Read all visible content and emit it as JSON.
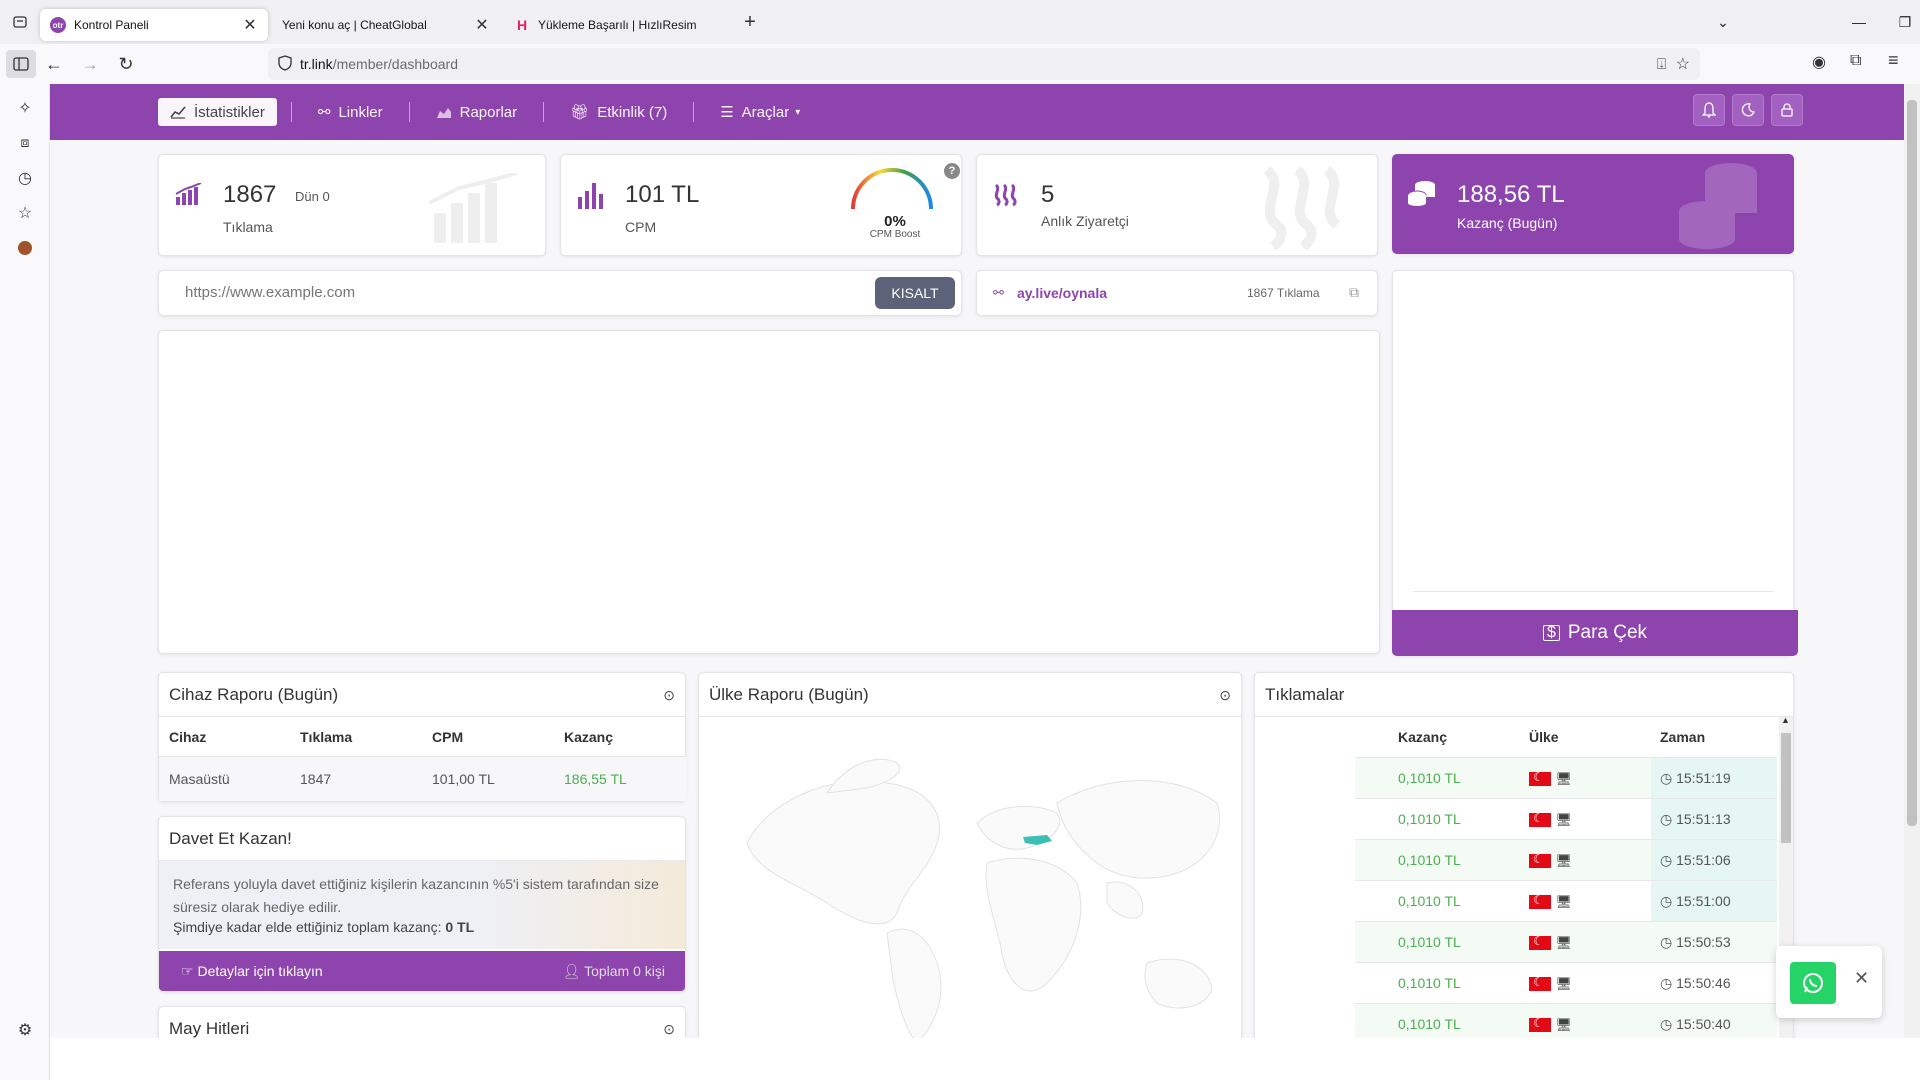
{
  "browser": {
    "tabs": [
      {
        "title": "Kontrol Paneli",
        "favicon": "otr"
      },
      {
        "title": "Yeni konu aç | CheatGlobal",
        "favicon": ""
      },
      {
        "title": "Yükleme Başarılı | HızlıResim",
        "favicon": "H"
      }
    ],
    "url_host": "tr.link",
    "url_path": "/member/dashboard"
  },
  "nav": {
    "items": [
      "İstatistikler",
      "Linkler",
      "Raporlar",
      "Etkinlik (7)",
      "Araçlar"
    ],
    "accent": "#8e44ad"
  },
  "stats": {
    "clicks": {
      "value": "1867",
      "yesterday": "Dün 0",
      "label": "Tıklama"
    },
    "cpm": {
      "value": "101 TL",
      "label": "CPM",
      "boost_value": "0%",
      "boost_label": "CPM Boost",
      "help": "?",
      "boost_percent": 0
    },
    "visitors": {
      "value": "5",
      "label": "Anlık Ziyaretçi"
    },
    "earnings": {
      "value": "188,56 TL",
      "label": "Kazanç (Bugün)"
    }
  },
  "shorten": {
    "placeholder": "https://www.example.com",
    "button": "KISALT"
  },
  "recent_link": {
    "url": "ay.live/oynala",
    "clicks": "1867 Tıklama"
  },
  "withdraw_button": "Para Çek",
  "device_report": {
    "title": "Cihaz Raporu (Bugün)",
    "headers": [
      "Cihaz",
      "Tıklama",
      "CPM",
      "Kazanç"
    ],
    "rows": [
      [
        "Masaüstü",
        "1847",
        "101,00 TL",
        "186,55 TL"
      ]
    ]
  },
  "invite": {
    "title": "Davet Et Kazan!",
    "text1": "Referans yoluyla davet ettiğiniz kişilerin kazancının %5'i sistem tarafından size süresiz olarak hediye edilir.",
    "text2": "Şimdiye kadar elde ettiğiniz toplam kazanç:",
    "total": "0 TL",
    "details_link": "Detaylar için tıklayın",
    "people": "Toplam 0 kişi"
  },
  "may_hits": {
    "title": "May Hitleri"
  },
  "country_report": {
    "title": "Ülke Raporu (Bugün)"
  },
  "clicks_panel": {
    "title": "Tıklamalar",
    "headers": [
      "Kazanç",
      "Ülke",
      "Zaman"
    ],
    "rows": [
      {
        "earn": "0,1010 TL",
        "time": "15:51:19"
      },
      {
        "earn": "0,1010 TL",
        "time": "15:51:13"
      },
      {
        "earn": "0,1010 TL",
        "time": "15:51:06"
      },
      {
        "earn": "0,1010 TL",
        "time": "15:51:00"
      },
      {
        "earn": "0,1010 TL",
        "time": "15:50:53"
      },
      {
        "earn": "0,1010 TL",
        "time": "15:50:46"
      },
      {
        "earn": "0,1010 TL",
        "time": "15:50:40"
      }
    ]
  }
}
